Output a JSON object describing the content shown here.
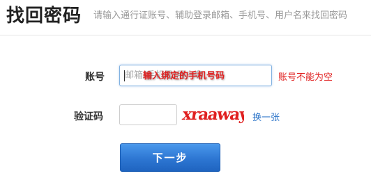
{
  "header": {
    "title": "找回密码",
    "subtitle": "请输入通行证账号、辅助登录邮箱、手机号、用户名来找回密码"
  },
  "form": {
    "account_label": "账号",
    "account_placeholder": "邮箱/手机号/用户名",
    "account_value": "",
    "account_overlay_hint": "输入绑定的手机号码",
    "account_error": "账号不能为空",
    "captcha_label": "验证码",
    "captcha_value": "",
    "captcha_text": "xraaway",
    "refresh_label": "换一张",
    "next_label": "下一步"
  },
  "colors": {
    "error": "#e02020",
    "link": "#2a73c8",
    "button": "#2d76d2",
    "captcha_text": "#e02020"
  }
}
